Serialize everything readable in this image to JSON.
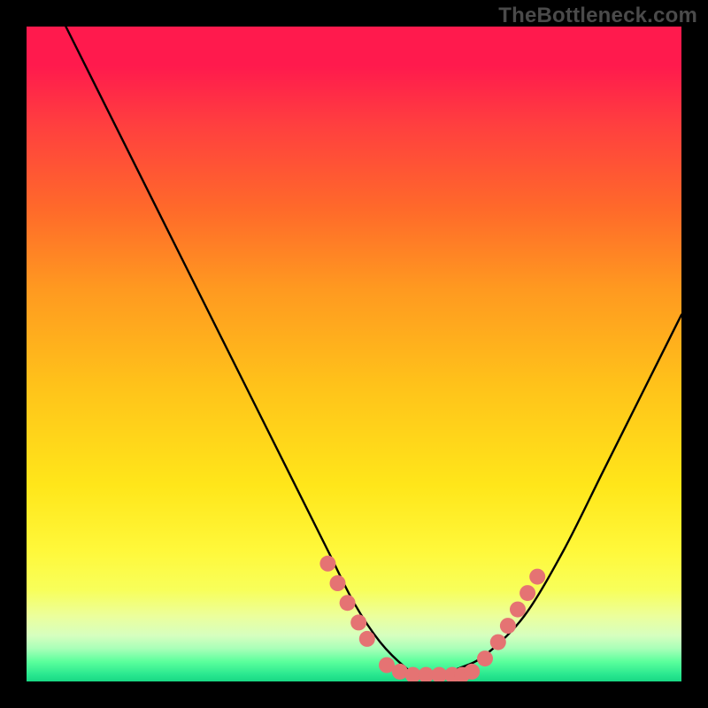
{
  "watermark": "TheBottleneck.com",
  "chart_data": {
    "type": "line",
    "title": "",
    "xlabel": "",
    "ylabel": "",
    "xlim": [
      0,
      100
    ],
    "ylim": [
      0,
      100
    ],
    "series": [
      {
        "name": "curve",
        "x": [
          6,
          12,
          20,
          30,
          40,
          46,
          50,
          54,
          58,
          60,
          63,
          66,
          70,
          76,
          82,
          88,
          94,
          100
        ],
        "values": [
          100,
          88,
          72,
          52,
          32,
          20,
          12,
          6,
          2,
          1,
          1,
          2,
          4,
          10,
          20,
          32,
          44,
          56
        ]
      }
    ],
    "markers": [
      {
        "x": 46.0,
        "y": 18.0
      },
      {
        "x": 47.5,
        "y": 15.0
      },
      {
        "x": 49.0,
        "y": 12.0
      },
      {
        "x": 50.7,
        "y": 9.0
      },
      {
        "x": 52.0,
        "y": 6.5
      },
      {
        "x": 55.0,
        "y": 2.5
      },
      {
        "x": 57.0,
        "y": 1.5
      },
      {
        "x": 59.0,
        "y": 1.0
      },
      {
        "x": 61.0,
        "y": 1.0
      },
      {
        "x": 63.0,
        "y": 1.0
      },
      {
        "x": 65.0,
        "y": 1.0
      },
      {
        "x": 66.5,
        "y": 1.0
      },
      {
        "x": 68.0,
        "y": 1.5
      },
      {
        "x": 70.0,
        "y": 3.5
      },
      {
        "x": 72.0,
        "y": 6.0
      },
      {
        "x": 73.5,
        "y": 8.5
      },
      {
        "x": 75.0,
        "y": 11.0
      },
      {
        "x": 76.5,
        "y": 13.5
      },
      {
        "x": 78.0,
        "y": 16.0
      }
    ],
    "marker_color": "#e57373",
    "curve_color": "#000000"
  }
}
